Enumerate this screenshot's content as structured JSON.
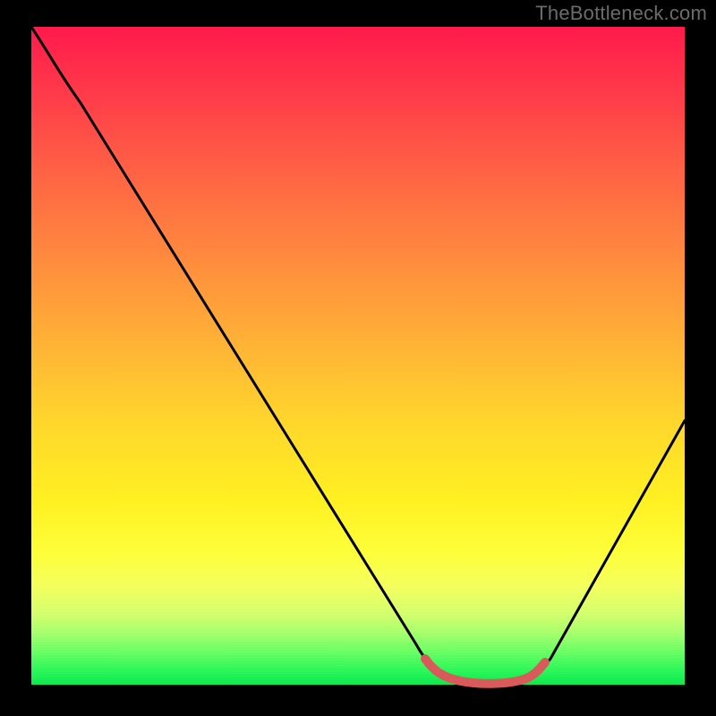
{
  "watermark": "TheBottleneck.com",
  "chart_data": {
    "type": "line",
    "title": "",
    "xlabel": "",
    "ylabel": "",
    "xlim": [
      0,
      100
    ],
    "ylim": [
      0,
      100
    ],
    "grid": false,
    "legend": false,
    "series": [
      {
        "name": "bottleneck-curve",
        "color": "#000000",
        "x": [
          0,
          4,
          10,
          20,
          30,
          40,
          50,
          58,
          62,
          66,
          70,
          74,
          76,
          78,
          82,
          88,
          94,
          100
        ],
        "y": [
          100,
          95,
          88,
          74,
          60,
          46,
          32,
          18,
          10,
          4,
          1,
          0,
          0,
          1,
          5,
          14,
          26,
          40
        ]
      },
      {
        "name": "optimal-range",
        "color": "#d85a5a",
        "x": [
          62,
          66,
          70,
          74,
          76,
          78
        ],
        "y": [
          10,
          4,
          1,
          0,
          0,
          2
        ]
      }
    ],
    "annotations": []
  }
}
